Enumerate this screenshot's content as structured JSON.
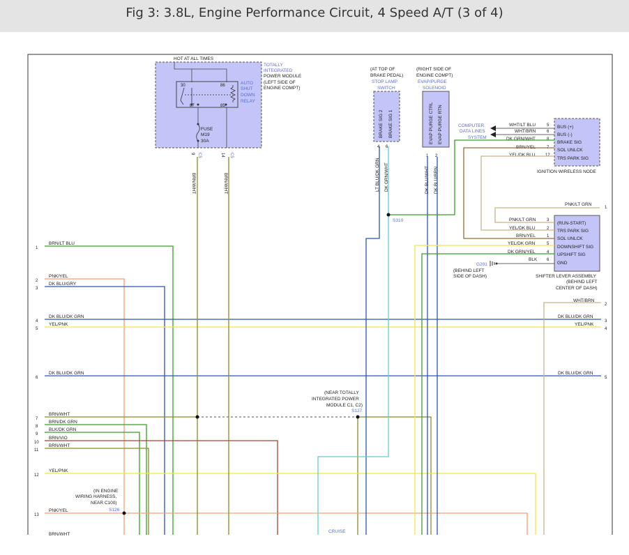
{
  "header": {
    "title": "Fig 3: 3.8L, Engine Performance Circuit, 4 Speed A/T (3 of 4)"
  },
  "colors": {
    "module_fill": "#c3c4f7",
    "module_border": "#555555",
    "label_blue": "#5a6fd8",
    "wire_green": "#3c9a2c",
    "wire_olive": "#8a8a2a",
    "wire_orange": "#f0a070",
    "wire_blue": "#2a55b0",
    "wire_yellow": "#f2e54a",
    "wire_cyan": "#5ecfd6",
    "wire_red": "#a0442a",
    "wire_brown": "#9a6a3a",
    "wire_tan": "#c9b48a"
  },
  "tipm": {
    "hot_label": "HOT AT ALL TIMES",
    "name": [
      "TOTALLY",
      "INTEGRATED",
      "POWER MODULE",
      "(LEFT SIDE OF",
      "ENGINE COMPT)"
    ],
    "relay_name": [
      "AUTO",
      "SHUT",
      "DOWN",
      "RELAY"
    ],
    "pin_30": "30",
    "pin_86": "86",
    "pin_87": "87",
    "pin_85": "85",
    "fuse": [
      "FUSE",
      "M19",
      "30A"
    ],
    "pin_9": "9",
    "pin_14": "14",
    "conn_c5a": "C5",
    "conn_c5b": "C5",
    "wire_9": "BRN/WHT",
    "wire_14": "BRN/WHT"
  },
  "stop_lamp": {
    "name": [
      "(AT TOP OF",
      "BRAKE PEDAL)",
      "STOP LAMP",
      "SWITCH"
    ],
    "pin_labels": [
      "BRAKE SIG 2",
      "BRAKE SIG 1"
    ],
    "pin_nums": [
      "4",
      "6"
    ],
    "wires": [
      "LT BLU/DK GRN",
      "DK GRN/WHT"
    ]
  },
  "evap": {
    "name": [
      "(RIGHT SIDE OF",
      "ENGINE COMPT)",
      "EVAP/PURGE",
      "SOLENOID"
    ],
    "pin_labels": [
      "EVAP PURGE CTRL",
      "EVAP PURGE RTN"
    ],
    "pin_nums": [
      "1",
      "2"
    ],
    "wires": [
      "DK BLU/WHT",
      "DK BLU/BRN"
    ]
  },
  "splices": {
    "s310": "S310",
    "s127": "S127",
    "s126": "S126"
  },
  "computer_data": [
    "COMPUTER",
    "DATA LINES",
    "SYSTEM"
  ],
  "ignition_node": {
    "name": "IGNITION WIRELESS NODE",
    "pins": [
      {
        "wire": "WHT/LT BLU",
        "num": "5",
        "label": "BUS (+)"
      },
      {
        "wire": "WHT/BRN",
        "num": "6",
        "label": "BUS (-)"
      },
      {
        "wire": "DK GRN/WHT",
        "num": "8",
        "label": "BRAKE SIG"
      },
      {
        "wire": "BRN/YEL",
        "num": "7",
        "label": "SOL UNLCK"
      },
      {
        "wire": "YEL/DK BLU",
        "num": "12",
        "label": "TRS PARK SIG"
      }
    ]
  },
  "shifter": {
    "name": [
      "SHIFTER LEVER ASSEMBLY",
      "(BEHIND LEFT",
      "CENTER OF DASH)"
    ],
    "top_wire": "PNK/LT GRN",
    "top_num": "1",
    "pins": [
      {
        "wire": "PNK/LT GRN",
        "num": "3",
        "label": "(RUN-START)"
      },
      {
        "wire": "YEL/DK BLU",
        "num": "2",
        "label": "TRS PARK SIG"
      },
      {
        "wire": "BRN/YEL",
        "num": "1",
        "label": "SOL UNLCK"
      },
      {
        "wire": "YEL/DK GRN",
        "num": "5",
        "label": "DOWNSHIFT SIG"
      },
      {
        "wire": "DK GRN/YEL",
        "num": "4",
        "label": "UPSHIFT SIG"
      },
      {
        "wire": "BLK",
        "num": "6",
        "label": "GND"
      }
    ],
    "ground": "G201",
    "ground_note": [
      "(BEHIND LEFT",
      "SIDE OF DASH)"
    ]
  },
  "left_wires": [
    {
      "num": "1",
      "label": "BRN/LT BLU"
    },
    {
      "num": "2",
      "label": "PNK/YEL"
    },
    {
      "num": "3",
      "label": "DK BLU/GRY"
    },
    {
      "num": "4",
      "label": "DK BLU/DK GRN"
    },
    {
      "num": "5",
      "label": "YEL/PNK"
    },
    {
      "num": "6",
      "label": "DK BLU/DK GRN"
    },
    {
      "num": "7",
      "label": "BRN/WHT"
    },
    {
      "num": "8",
      "label": "BRN/DK GRN"
    },
    {
      "num": "9",
      "label": "BLK/DK GRN"
    },
    {
      "num": "10",
      "label": "BRN/VIO"
    },
    {
      "num": "11",
      "label": "BRN/WHT"
    },
    {
      "num": "12",
      "label": "YEL/PNK"
    },
    {
      "num": "13",
      "label": "PNK/YEL"
    },
    {
      "num": "",
      "label": "BRN/WHT"
    }
  ],
  "right_wires": [
    {
      "num": "2",
      "label": "WHT/BRN"
    },
    {
      "num": "3",
      "label": "DK BLU/DK GRN"
    },
    {
      "num": "4",
      "label": "YEL/PNK"
    },
    {
      "num": "5",
      "label": "DK BLU/DK GRN"
    }
  ],
  "near_tipm_note": [
    "(NEAR TOTALLY",
    "INTEGRATED POWER",
    "MODULE C1, C2)"
  ],
  "engine_harness_note": [
    "(IN ENGINE",
    "WIRING HARNESS,",
    "NEAR C100)"
  ],
  "cruise": "CRUISE"
}
